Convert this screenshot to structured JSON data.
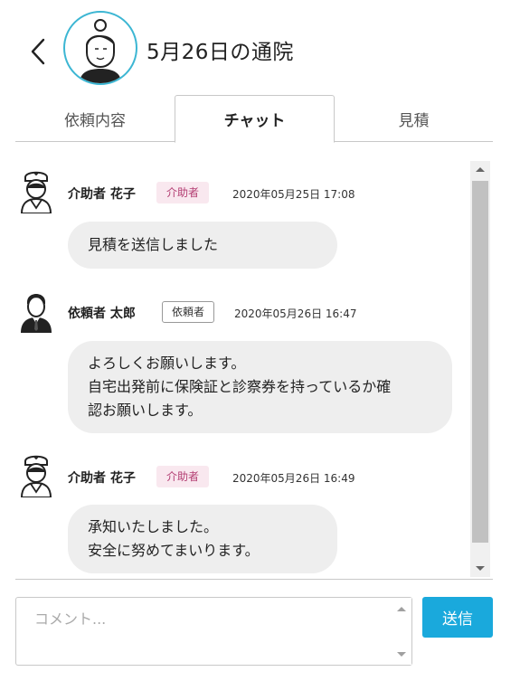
{
  "header": {
    "title": "5月26日の通院",
    "back_icon": "chevron-left-icon",
    "avatar_icon": "elderly-woman-avatar-icon"
  },
  "tabs": [
    {
      "label": "依頼内容",
      "active": false
    },
    {
      "label": "チャット",
      "active": true
    },
    {
      "label": "見積",
      "active": false
    }
  ],
  "messages": [
    {
      "sender": "介助者 花子",
      "role": "介助者",
      "role_type": "helper",
      "avatar_icon": "nurse-avatar-icon",
      "timestamp": "2020年05月25日 17:08",
      "lines": [
        "見積を送信しました"
      ]
    },
    {
      "sender": "依頼者 太郎",
      "role": "依頼者",
      "role_type": "client",
      "avatar_icon": "man-avatar-icon",
      "timestamp": "2020年05月26日 16:47",
      "lines": [
        "よろしくお願いします。",
        "自宅出発前に保険証と診察券を持っているか確",
        "認お願いします。"
      ]
    },
    {
      "sender": "介助者 花子",
      "role": "介助者",
      "role_type": "helper",
      "avatar_icon": "nurse-avatar-icon",
      "timestamp": "2020年05月26日 16:49",
      "lines": [
        "承知いたしました。",
        "安全に努めてまいります。"
      ]
    }
  ],
  "comment": {
    "placeholder": "コメント...",
    "value": ""
  },
  "send_button": {
    "label": "送信"
  },
  "colors": {
    "accent": "#1aa9dc",
    "avatar_ring": "#3cb6d3",
    "helper_badge_bg": "#f9e8ef",
    "helper_badge_text": "#b33d72",
    "bubble_bg": "#eeeeee"
  }
}
